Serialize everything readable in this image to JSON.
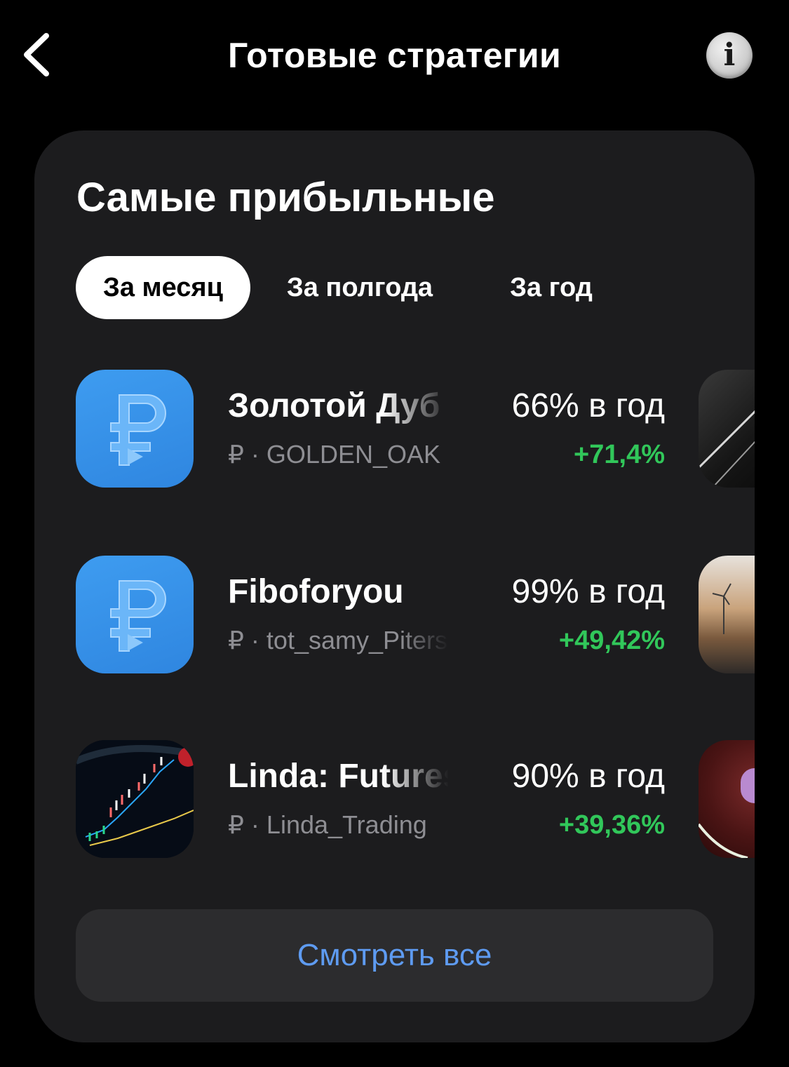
{
  "header": {
    "title": "Готовые стратегии",
    "back_icon": "chevron-left-icon",
    "info_icon": "info-icon",
    "info_glyph": "i"
  },
  "section": {
    "title": "Самые прибыльные",
    "tabs": [
      {
        "label": "За месяц",
        "active": true
      },
      {
        "label": "За полгода",
        "active": false
      },
      {
        "label": "За год",
        "active": false
      }
    ]
  },
  "strategies": [
    {
      "name": "Золотой Дуб",
      "currency": "₽",
      "author": "GOLDEN_OAK",
      "yield": "66% в год",
      "return": "+71,4%",
      "logo": "ruble-logo-icon"
    },
    {
      "name": "Fiboforyou",
      "currency": "₽",
      "author": "tot_samy_Piterski",
      "yield": "99% в год",
      "return": "+49,42%",
      "logo": "ruble-logo-icon"
    },
    {
      "name": "Linda: Futures",
      "currency": "₽",
      "author": "Linda_Trading",
      "yield": "90% в год",
      "return": "+39,36%",
      "logo": "candlestick-chart-image"
    }
  ],
  "see_all_label": "Смотреть все",
  "colors": {
    "background": "#000000",
    "card": "#1c1c1e",
    "positive": "#31c75a",
    "link": "#5e9bf1",
    "secondary_text": "#8e8e93"
  }
}
